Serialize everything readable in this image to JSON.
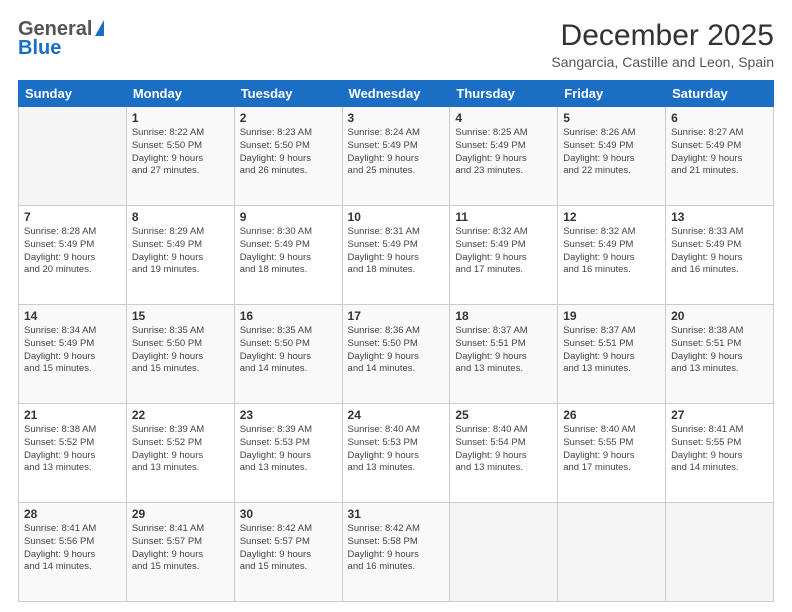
{
  "logo": {
    "line1": "General",
    "line2": "Blue"
  },
  "title": "December 2025",
  "subtitle": "Sangarcia, Castille and Leon, Spain",
  "header_days": [
    "Sunday",
    "Monday",
    "Tuesday",
    "Wednesday",
    "Thursday",
    "Friday",
    "Saturday"
  ],
  "weeks": [
    [
      {
        "day": "",
        "info": ""
      },
      {
        "day": "1",
        "info": "Sunrise: 8:22 AM\nSunset: 5:50 PM\nDaylight: 9 hours\nand 27 minutes."
      },
      {
        "day": "2",
        "info": "Sunrise: 8:23 AM\nSunset: 5:50 PM\nDaylight: 9 hours\nand 26 minutes."
      },
      {
        "day": "3",
        "info": "Sunrise: 8:24 AM\nSunset: 5:49 PM\nDaylight: 9 hours\nand 25 minutes."
      },
      {
        "day": "4",
        "info": "Sunrise: 8:25 AM\nSunset: 5:49 PM\nDaylight: 9 hours\nand 23 minutes."
      },
      {
        "day": "5",
        "info": "Sunrise: 8:26 AM\nSunset: 5:49 PM\nDaylight: 9 hours\nand 22 minutes."
      },
      {
        "day": "6",
        "info": "Sunrise: 8:27 AM\nSunset: 5:49 PM\nDaylight: 9 hours\nand 21 minutes."
      }
    ],
    [
      {
        "day": "7",
        "info": "Sunrise: 8:28 AM\nSunset: 5:49 PM\nDaylight: 9 hours\nand 20 minutes."
      },
      {
        "day": "8",
        "info": "Sunrise: 8:29 AM\nSunset: 5:49 PM\nDaylight: 9 hours\nand 19 minutes."
      },
      {
        "day": "9",
        "info": "Sunrise: 8:30 AM\nSunset: 5:49 PM\nDaylight: 9 hours\nand 18 minutes."
      },
      {
        "day": "10",
        "info": "Sunrise: 8:31 AM\nSunset: 5:49 PM\nDaylight: 9 hours\nand 18 minutes."
      },
      {
        "day": "11",
        "info": "Sunrise: 8:32 AM\nSunset: 5:49 PM\nDaylight: 9 hours\nand 17 minutes."
      },
      {
        "day": "12",
        "info": "Sunrise: 8:32 AM\nSunset: 5:49 PM\nDaylight: 9 hours\nand 16 minutes."
      },
      {
        "day": "13",
        "info": "Sunrise: 8:33 AM\nSunset: 5:49 PM\nDaylight: 9 hours\nand 16 minutes."
      }
    ],
    [
      {
        "day": "14",
        "info": "Sunrise: 8:34 AM\nSunset: 5:49 PM\nDaylight: 9 hours\nand 15 minutes."
      },
      {
        "day": "15",
        "info": "Sunrise: 8:35 AM\nSunset: 5:50 PM\nDaylight: 9 hours\nand 15 minutes."
      },
      {
        "day": "16",
        "info": "Sunrise: 8:35 AM\nSunset: 5:50 PM\nDaylight: 9 hours\nand 14 minutes."
      },
      {
        "day": "17",
        "info": "Sunrise: 8:36 AM\nSunset: 5:50 PM\nDaylight: 9 hours\nand 14 minutes."
      },
      {
        "day": "18",
        "info": "Sunrise: 8:37 AM\nSunset: 5:51 PM\nDaylight: 9 hours\nand 13 minutes."
      },
      {
        "day": "19",
        "info": "Sunrise: 8:37 AM\nSunset: 5:51 PM\nDaylight: 9 hours\nand 13 minutes."
      },
      {
        "day": "20",
        "info": "Sunrise: 8:38 AM\nSunset: 5:51 PM\nDaylight: 9 hours\nand 13 minutes."
      }
    ],
    [
      {
        "day": "21",
        "info": "Sunrise: 8:38 AM\nSunset: 5:52 PM\nDaylight: 9 hours\nand 13 minutes."
      },
      {
        "day": "22",
        "info": "Sunrise: 8:39 AM\nSunset: 5:52 PM\nDaylight: 9 hours\nand 13 minutes."
      },
      {
        "day": "23",
        "info": "Sunrise: 8:39 AM\nSunset: 5:53 PM\nDaylight: 9 hours\nand 13 minutes."
      },
      {
        "day": "24",
        "info": "Sunrise: 8:40 AM\nSunset: 5:53 PM\nDaylight: 9 hours\nand 13 minutes."
      },
      {
        "day": "25",
        "info": "Sunrise: 8:40 AM\nSunset: 5:54 PM\nDaylight: 9 hours\nand 13 minutes."
      },
      {
        "day": "26",
        "info": "Sunrise: 8:40 AM\nSunset: 5:55 PM\nDaylight: 9 hours\nand 17 minutes."
      },
      {
        "day": "27",
        "info": "Sunrise: 8:41 AM\nSunset: 5:55 PM\nDaylight: 9 hours\nand 14 minutes."
      }
    ],
    [
      {
        "day": "28",
        "info": "Sunrise: 8:41 AM\nSunset: 5:56 PM\nDaylight: 9 hours\nand 14 minutes."
      },
      {
        "day": "29",
        "info": "Sunrise: 8:41 AM\nSunset: 5:57 PM\nDaylight: 9 hours\nand 15 minutes."
      },
      {
        "day": "30",
        "info": "Sunrise: 8:42 AM\nSunset: 5:57 PM\nDaylight: 9 hours\nand 15 minutes."
      },
      {
        "day": "31",
        "info": "Sunrise: 8:42 AM\nSunset: 5:58 PM\nDaylight: 9 hours\nand 16 minutes."
      },
      {
        "day": "",
        "info": ""
      },
      {
        "day": "",
        "info": ""
      },
      {
        "day": "",
        "info": ""
      }
    ]
  ]
}
